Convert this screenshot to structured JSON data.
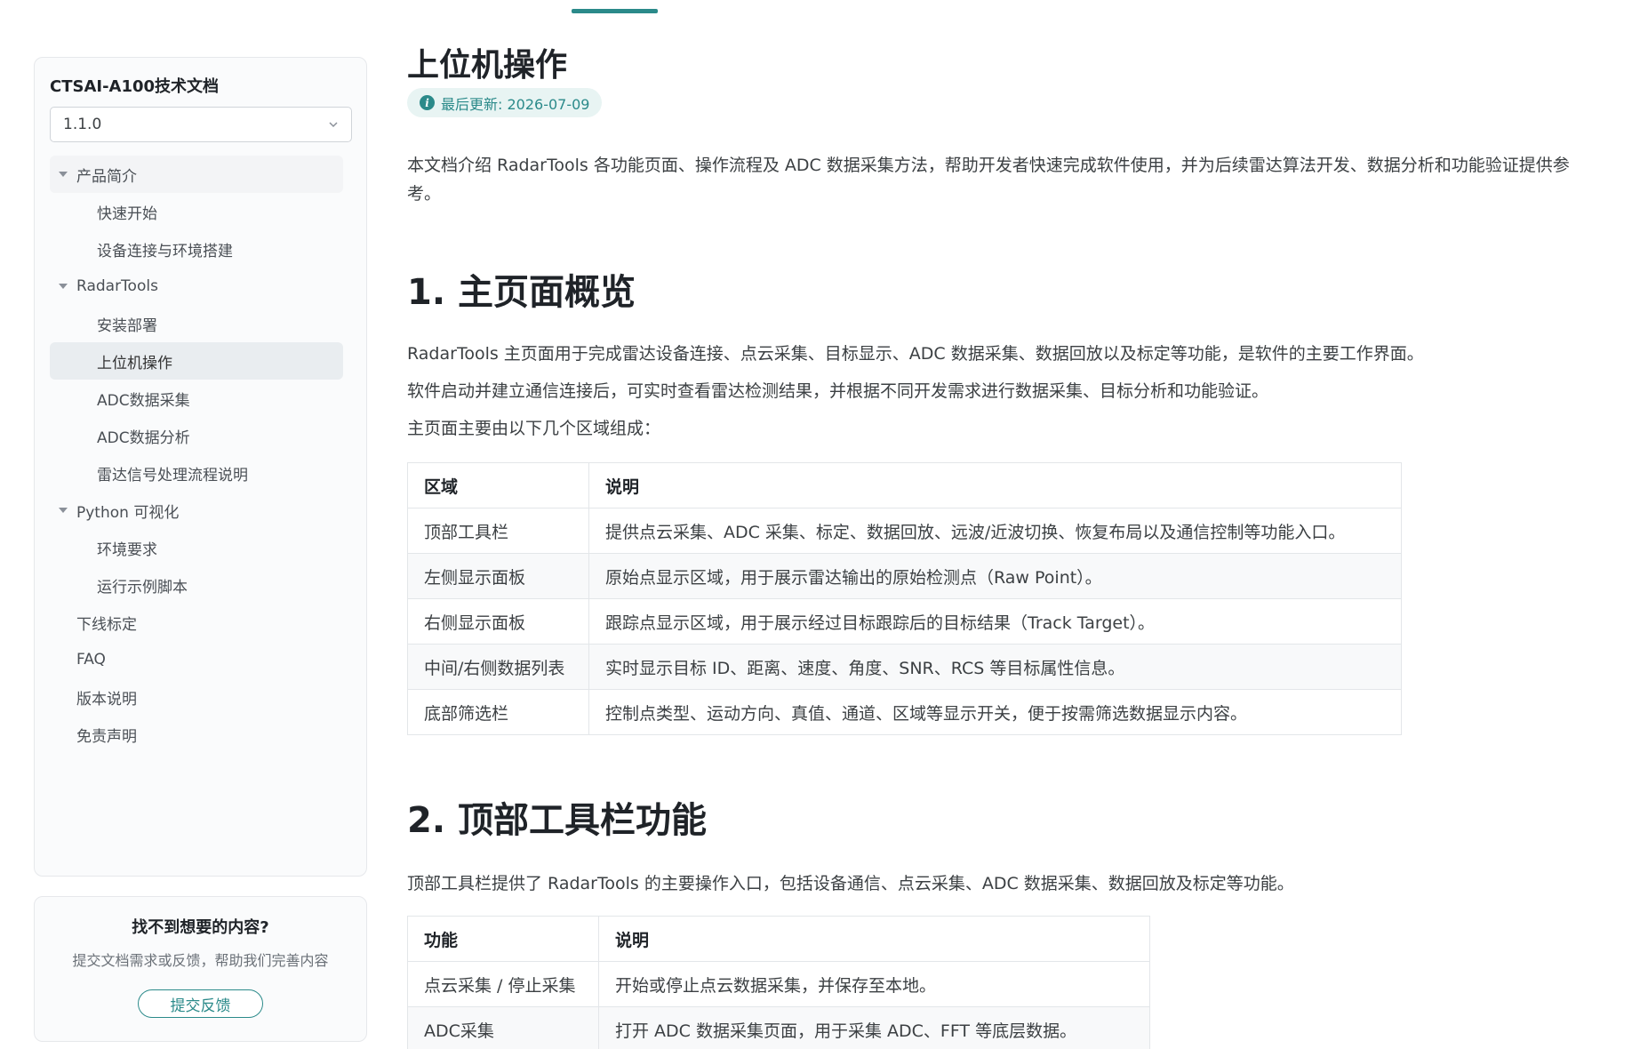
{
  "sidebar": {
    "doc_title": "CTSAI-A100技术文档",
    "version": "1.1.0",
    "items": [
      {
        "label": "产品简介"
      },
      {
        "label": "快速开始"
      },
      {
        "label": "设备连接与环境搭建"
      },
      {
        "label": "RadarTools"
      },
      {
        "label": "安装部署"
      },
      {
        "label": "上位机操作"
      },
      {
        "label": "ADC数据采集"
      },
      {
        "label": "ADC数据分析"
      },
      {
        "label": "雷达信号处理流程说明"
      },
      {
        "label": "Python 可视化"
      },
      {
        "label": "环境要求"
      },
      {
        "label": "运行示例脚本"
      },
      {
        "label": "下线标定"
      },
      {
        "label": "FAQ"
      },
      {
        "label": "版本说明"
      },
      {
        "label": "免责声明"
      }
    ]
  },
  "feedback": {
    "title": "找不到想要的内容?",
    "description": "提交文档需求或反馈，帮助我们完善内容",
    "button": "提交反馈"
  },
  "main": {
    "title": "上位机操作",
    "updated": "最后更新: 2026-07-09",
    "intro": "本文档介绍 RadarTools 各功能页面、操作流程及 ADC 数据采集方法，帮助开发者快速完成软件使用，并为后续雷达算法开发、数据分析和功能验证提供参考。",
    "section1": {
      "heading": "1. 主页面概览",
      "p1": "RadarTools 主页面用于完成雷达设备连接、点云采集、目标显示、ADC 数据采集、数据回放以及标定等功能，是软件的主要工作界面。",
      "p2": "软件启动并建立通信连接后，可实时查看雷达检测结果，并根据不同开发需求进行数据采集、目标分析和功能验证。",
      "p3": "主页面主要由以下几个区域组成：",
      "table": {
        "headers": [
          "区域",
          "说明"
        ],
        "rows": [
          [
            "顶部工具栏",
            "提供点云采集、ADC 采集、标定、数据回放、远波/近波切换、恢复布局以及通信控制等功能入口。"
          ],
          [
            "左侧显示面板",
            "原始点显示区域，用于展示雷达输出的原始检测点（Raw Point）。"
          ],
          [
            "右侧显示面板",
            "跟踪点显示区域，用于展示经过目标跟踪后的目标结果（Track Target）。"
          ],
          [
            "中间/右侧数据列表",
            "实时显示目标 ID、距离、速度、角度、SNR、RCS 等目标属性信息。"
          ],
          [
            "底部筛选栏",
            "控制点类型、运动方向、真值、通道、区域等显示开关，便于按需筛选数据显示内容。"
          ]
        ]
      }
    },
    "section2": {
      "heading": "2. 顶部工具栏功能",
      "p1": "顶部工具栏提供了 RadarTools 的主要操作入口，包括设备通信、点云采集、ADC 数据采集、数据回放及标定等功能。",
      "table": {
        "headers": [
          "功能",
          "说明"
        ],
        "rows": [
          [
            "点云采集 / 停止采集",
            "开始或停止点云数据采集，并保存至本地。"
          ],
          [
            "ADC采集",
            "打开 ADC 数据采集页面，用于采集 ADC、FFT 等底层数据。"
          ]
        ]
      }
    }
  }
}
